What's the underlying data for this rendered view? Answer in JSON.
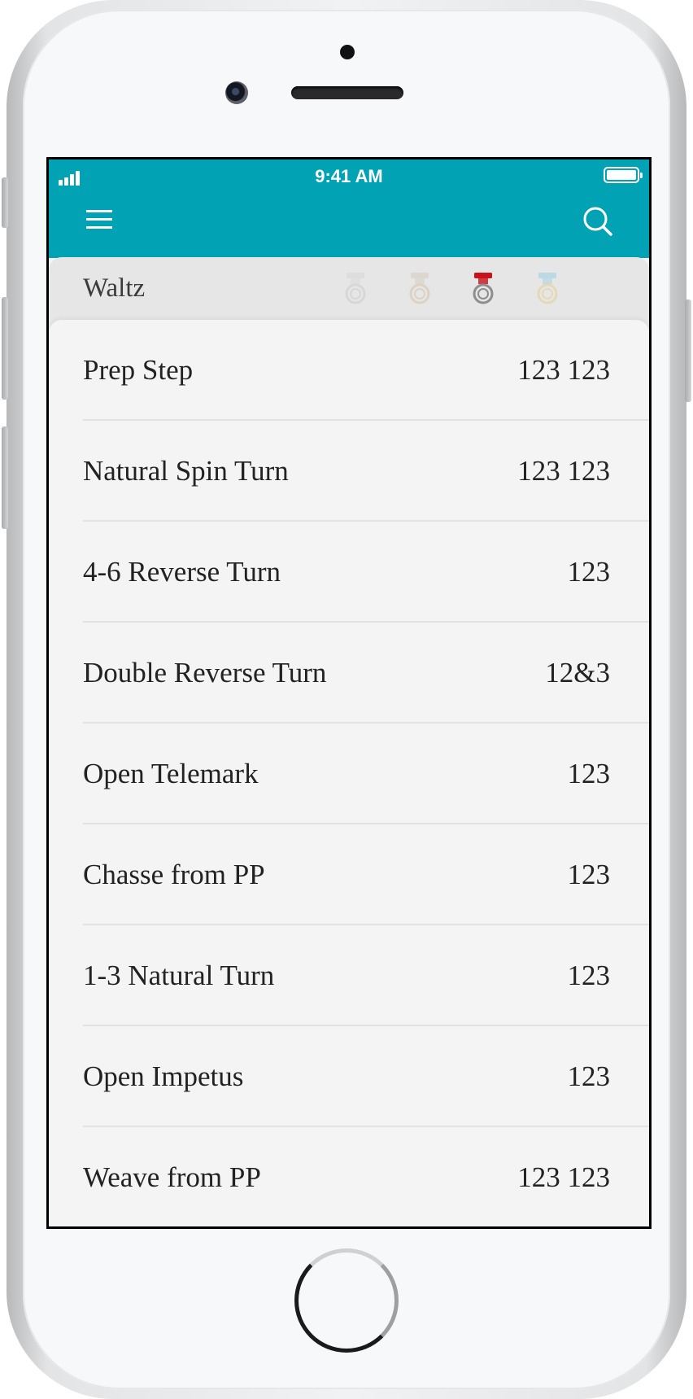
{
  "status_bar": {
    "time": "9:41 AM"
  },
  "appbar": {
    "menu_icon": "hamburger-menu-icon",
    "search_icon": "search-icon",
    "color": "#02a2b5"
  },
  "section": {
    "title": "Waltz",
    "medals": [
      {
        "name": "pre-bronze-medal-icon",
        "ribbon": "#d9d9d9",
        "ring": "#d0d0d0",
        "active": false
      },
      {
        "name": "bronze-medal-icon",
        "ribbon": "#d8cfc4",
        "ring": "#d8c7b2",
        "active": false
      },
      {
        "name": "silver-medal-icon",
        "ribbon": "#c8131b",
        "ring": "#8e8e8e",
        "active": true
      },
      {
        "name": "gold-medal-icon",
        "ribbon": "#a9d3e3",
        "ring": "#e4d3a0",
        "active": false
      }
    ]
  },
  "figures": [
    {
      "name": "Prep Step",
      "count": "123 123"
    },
    {
      "name": "Natural Spin Turn",
      "count": "123 123"
    },
    {
      "name": "4-6 Reverse Turn",
      "count": "123"
    },
    {
      "name": "Double Reverse Turn",
      "count": "12&3"
    },
    {
      "name": "Open Telemark",
      "count": "123"
    },
    {
      "name": "Chasse from PP",
      "count": "123"
    },
    {
      "name": "1-3 Natural Turn",
      "count": "123"
    },
    {
      "name": "Open Impetus",
      "count": "123"
    },
    {
      "name": "Weave from PP",
      "count": "123 123"
    }
  ]
}
